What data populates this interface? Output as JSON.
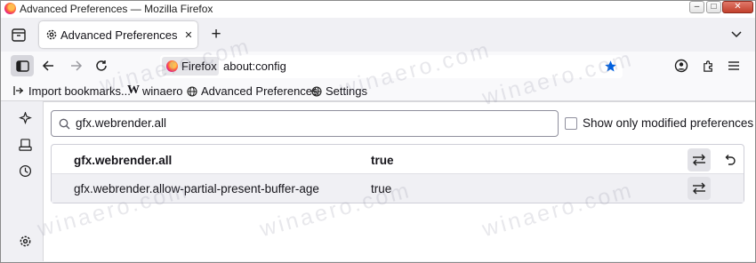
{
  "window": {
    "title": "Advanced Preferences — Mozilla Firefox",
    "minimize": "–",
    "maximize": "□",
    "close": "✕"
  },
  "tab": {
    "label": "Advanced Preferences",
    "close": "✕",
    "new_tab": "+",
    "list_all": "⌄"
  },
  "urlbar": {
    "identity_label": "Firefox",
    "url": "about:config"
  },
  "bookmarks": [
    {
      "label": "Import bookmarks...",
      "icon": "import-icon"
    },
    {
      "label": "winaero",
      "icon": "W"
    },
    {
      "label": "Advanced Preferences",
      "icon": "globe-icon"
    },
    {
      "label": "Settings",
      "icon": "globe-icon"
    }
  ],
  "search": {
    "value": "gfx.webrender.all"
  },
  "filter": {
    "label": "Show only modified preferences",
    "checked": false
  },
  "prefs": [
    {
      "name": "gfx.webrender.all",
      "value": "true",
      "modified": true
    },
    {
      "name": "gfx.webrender.allow-partial-present-buffer-age",
      "value": "true",
      "modified": false
    }
  ],
  "watermark": "winaero.com",
  "colors": {
    "accent_star": "#0060df",
    "close_button": "#c2402c",
    "row_alt": "#f0f0f4"
  }
}
